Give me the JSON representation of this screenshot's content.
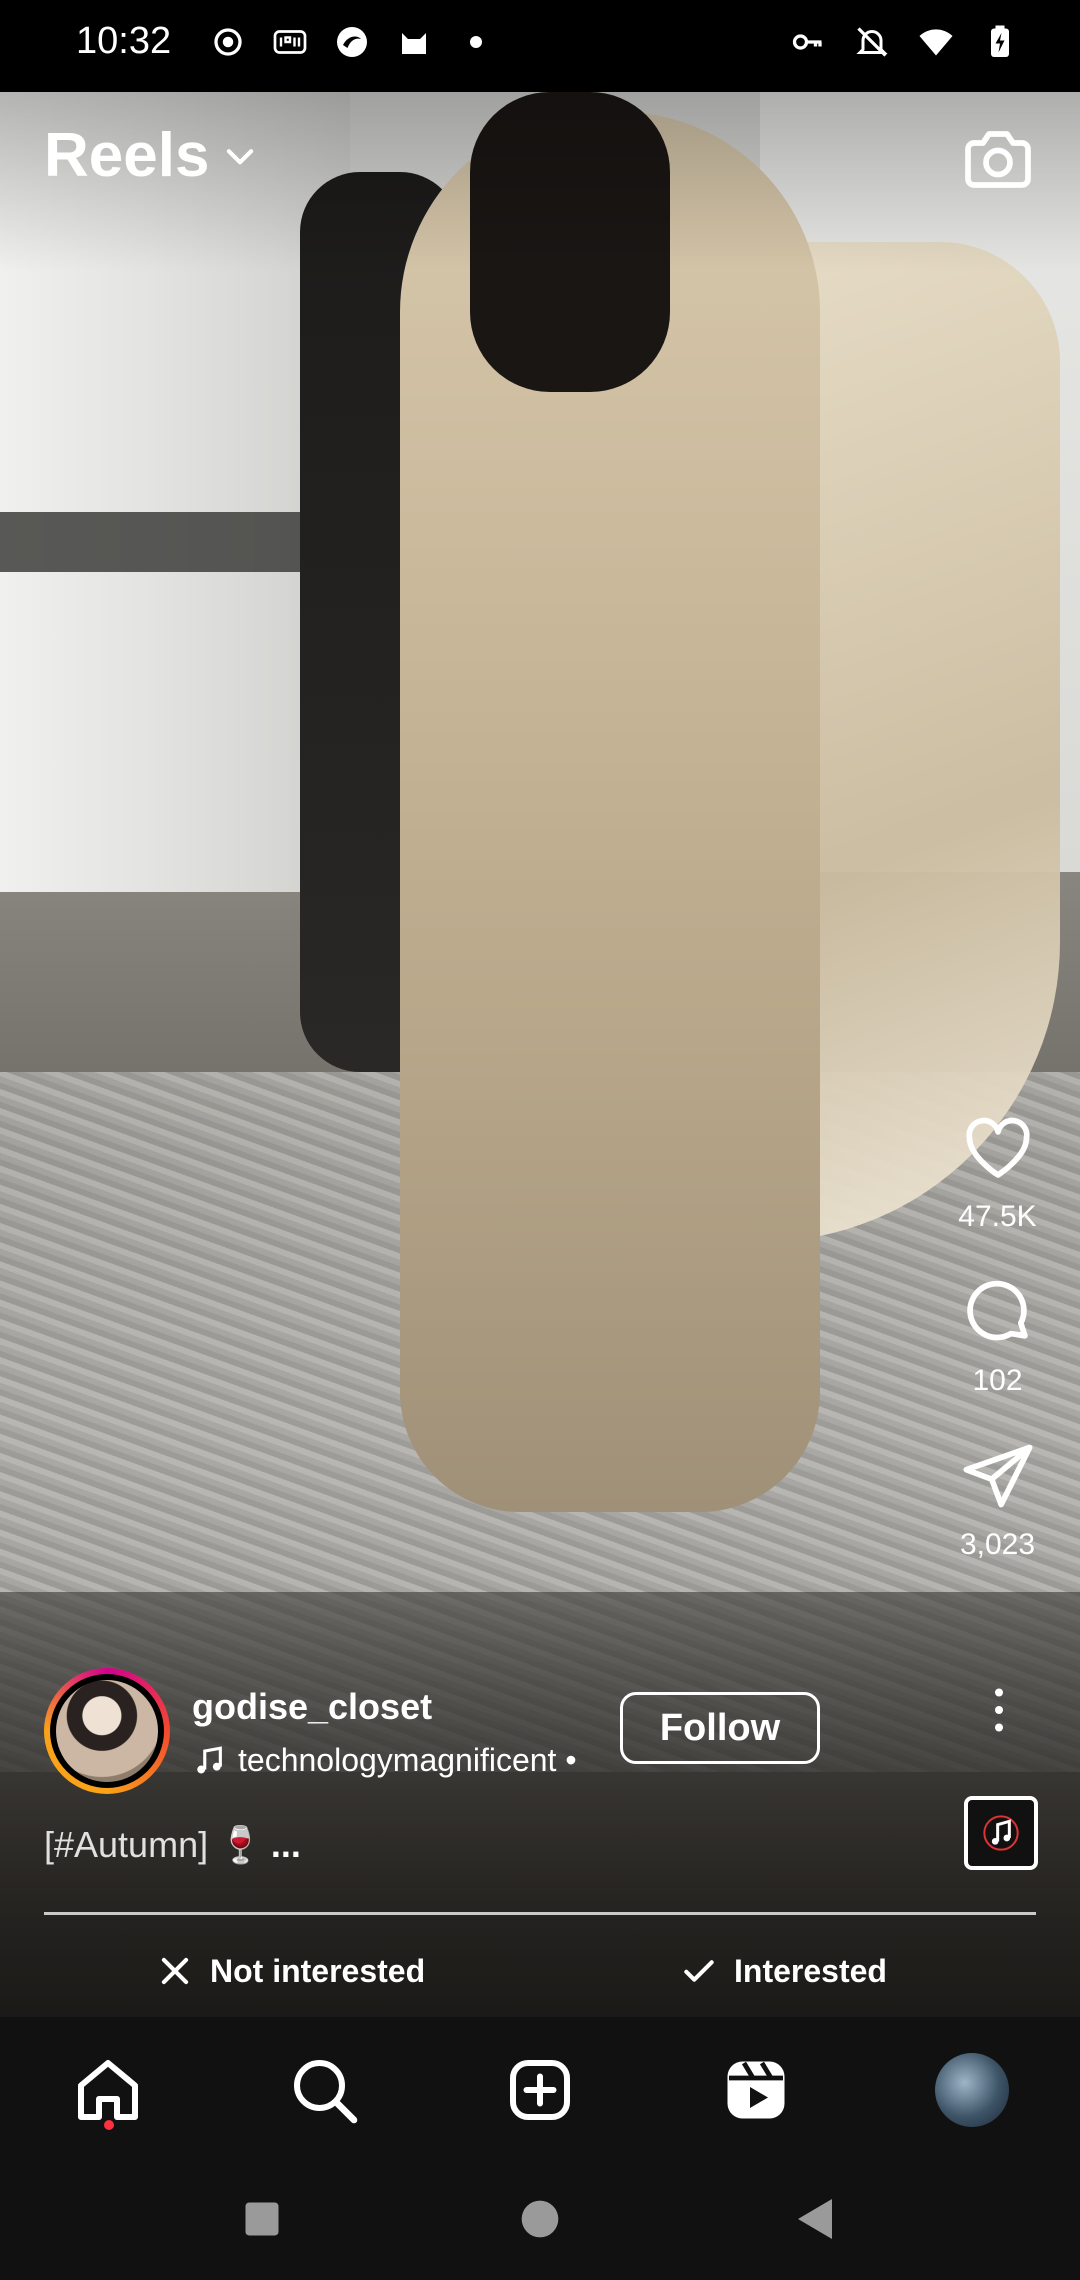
{
  "status_bar": {
    "time": "10:32",
    "left_icons": [
      "record-icon",
      "iqiyi-icon",
      "app-icon",
      "cat-icon",
      "dot-icon"
    ],
    "right_icons": [
      "key-icon",
      "bell-off-icon",
      "wifi-icon",
      "battery-charging-icon"
    ]
  },
  "header": {
    "title": "Reels",
    "camera_icon": "camera-icon"
  },
  "actions": {
    "like_count": "47.5K",
    "comment_count": "102",
    "share_count": "3,023"
  },
  "author": {
    "username": "godise_closet",
    "audio": "technologymagnificent •",
    "follow_label": "Follow"
  },
  "caption": {
    "text": "[#Autumn] 🍷",
    "more": "..."
  },
  "feedback": {
    "not_interested": "Not interested",
    "interested": "Interested"
  },
  "bottom_nav": {
    "items": [
      "home-icon",
      "search-icon",
      "create-icon",
      "reels-icon",
      "profile-avatar"
    ],
    "active": "home",
    "badge_color": "#ff3040"
  },
  "colors": {
    "background": "#000000",
    "nav_background": "#111111",
    "text": "#ffffff"
  }
}
